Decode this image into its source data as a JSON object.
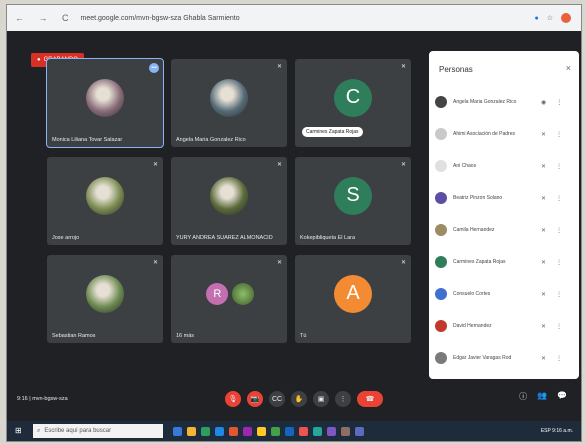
{
  "browser": {
    "nav": "← → C",
    "url": "meet.google.com/mvn-bgsw-sza  Ghabla Sarmiento"
  },
  "meet": {
    "recording_label": "GRABANDO",
    "tiles": [
      {
        "name": "Monica Liliana Tovar Salazar",
        "kind": "photo",
        "color": "#8a6d7a",
        "selected": true,
        "badge": "•••"
      },
      {
        "name": "Angela Maria Gonzalez Rico",
        "kind": "photo",
        "color": "#566c78",
        "mic": "✕"
      },
      {
        "name": "",
        "kind": "letter",
        "letter": "C",
        "color": "#2e7d5b",
        "mic": "✕",
        "speaking_badge": "Carmines Zapata Rojas"
      },
      {
        "name": "Jose arrojo",
        "kind": "photo",
        "color": "#7b8c52",
        "mic": "✕"
      },
      {
        "name": "YURY ANDREA SUAREZ ALMONACID",
        "kind": "photo",
        "color": "#5a6a3a",
        "mic": "✕"
      },
      {
        "name": "Kokepibliqueta El Lara",
        "kind": "letter",
        "letter": "S",
        "color": "#2e7d5b",
        "mic": "✕"
      },
      {
        "name": "Sebastian Ramos",
        "kind": "photo",
        "color": "#6b8a4f",
        "mic": "✕"
      },
      {
        "name": "16 más",
        "kind": "group",
        "letter": "R",
        "color": "#c46fb0",
        "mic": "✕"
      },
      {
        "name": "Tú",
        "kind": "letter",
        "letter": "A",
        "color": "#f28b32",
        "mic": "✕"
      }
    ],
    "people_panel": {
      "title": "Personas",
      "close": "×",
      "people": [
        {
          "name": "Angela Maria Gonzalez Rico",
          "color": "#444444",
          "mic": "◉"
        },
        {
          "name": "Ahimi Asociación de Padres",
          "color": "#c9c9c9",
          "mic": "✕"
        },
        {
          "name": "Ani Chaos",
          "color": "#e0e0e0",
          "mic": "✕"
        },
        {
          "name": "Beatriz Pinzon Solano",
          "color": "#5c4ea3",
          "mic": "✕"
        },
        {
          "name": "Camila Hernandez",
          "color": "#9d8b63",
          "mic": "✕"
        },
        {
          "name": "Carmines Zapata Rojas",
          "color": "#2e7d5b",
          "mic": "✕"
        },
        {
          "name": "Consuelo Cortes",
          "color": "#3f6fd1",
          "mic": "✕"
        },
        {
          "name": "David Hernandez",
          "color": "#c0392b",
          "mic": "✕"
        },
        {
          "name": "Edgar Javier Varagas Rod",
          "color": "#7a7a7a",
          "mic": "✕"
        }
      ]
    },
    "bottom": {
      "meeting_info": "9:16 | mvn-bgsw-sza",
      "controls": [
        "🎙",
        "📷",
        "CC",
        "✋",
        "▣",
        "⋮"
      ],
      "end_call": "☎",
      "right_icons": [
        "ⓘ",
        "👥",
        "💬"
      ]
    }
  },
  "taskbar": {
    "win": "⊞",
    "search_placeholder": "Escribe aquí para buscar",
    "tray": "ESP  9:16 a.m."
  },
  "colors": {
    "meet_bg": "#202124",
    "tile_bg": "#3c4043",
    "red": "#ea4335"
  }
}
